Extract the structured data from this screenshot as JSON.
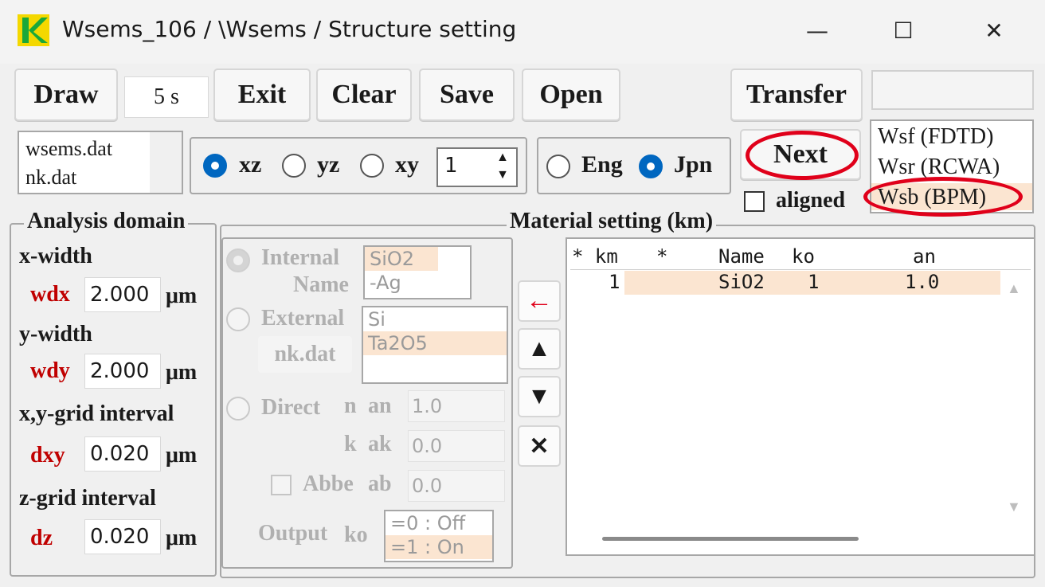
{
  "window": {
    "title": "Wsems_106 / \\Wsems / Structure setting",
    "minimize_label": "—",
    "maximize_label": "☐",
    "close_label": "✕"
  },
  "toolbar": {
    "draw_label": "Draw",
    "time_value": "5 s",
    "exit_label": "Exit",
    "clear_label": "Clear",
    "save_label": "Save",
    "open_label": "Open",
    "transfer_label": "Transfer",
    "next_label": "Next",
    "aligned_label": "aligned"
  },
  "files": [
    "wsems.dat",
    "nk.dat"
  ],
  "plane": {
    "options": [
      "xz",
      "yz",
      "xy"
    ],
    "selected": "xz",
    "spin_value": "1"
  },
  "language": {
    "options": [
      "Eng",
      "Jpn"
    ],
    "selected": "Jpn"
  },
  "solvers": [
    "Wsf (FDTD)",
    "Wsr (RCWA)",
    "Wsb (BPM)"
  ],
  "analysis": {
    "title": "Analysis domain",
    "xwidth_label": "x-width",
    "wdx_label": "wdx",
    "wdx_value": "2.000",
    "ywidth_label": "y-width",
    "wdy_label": "wdy",
    "wdy_value": "2.000",
    "xygrid_label": "x,y-grid interval",
    "dxy_label": "dxy",
    "dxy_value": "0.020",
    "zgrid_label": "z-grid interval",
    "dz_label": "dz",
    "dz_value": "0.020",
    "unit": "μm"
  },
  "material": {
    "title": "Material setting (km)",
    "internal_label": "Internal",
    "name_label": "Name",
    "internal_list": [
      "SiO2",
      "-Ag"
    ],
    "external_label": "External",
    "nkdat_label": "nk.dat",
    "external_list": [
      "Si",
      "Ta2O5"
    ],
    "direct_label": "Direct",
    "n_label": "n",
    "an_label": "an",
    "an_value": "1.0",
    "k_label": "k",
    "ak_label": "ak",
    "ak_value": "0.0",
    "abbe_label": "Abbe",
    "ab_label": "ab",
    "ab_value": "0.0",
    "output_label": "Output",
    "ko_label": "ko",
    "output_list": [
      "=0 : Off",
      "=1 : On"
    ],
    "add_icon": "←",
    "up_icon": "▲",
    "down_icon": "▼",
    "delete_icon": "✕"
  },
  "table": {
    "headers": [
      "* km",
      "*",
      "Name",
      "ko",
      "an"
    ],
    "rows": [
      {
        "km": "1",
        "star": "",
        "name": "SiO2",
        "ko": "1",
        "an": "1.0"
      }
    ]
  },
  "colors": {
    "accent": "#0067c0",
    "highlight": "#fbe5d1",
    "annotation": "#e0001a",
    "label_red": "#c00000"
  }
}
